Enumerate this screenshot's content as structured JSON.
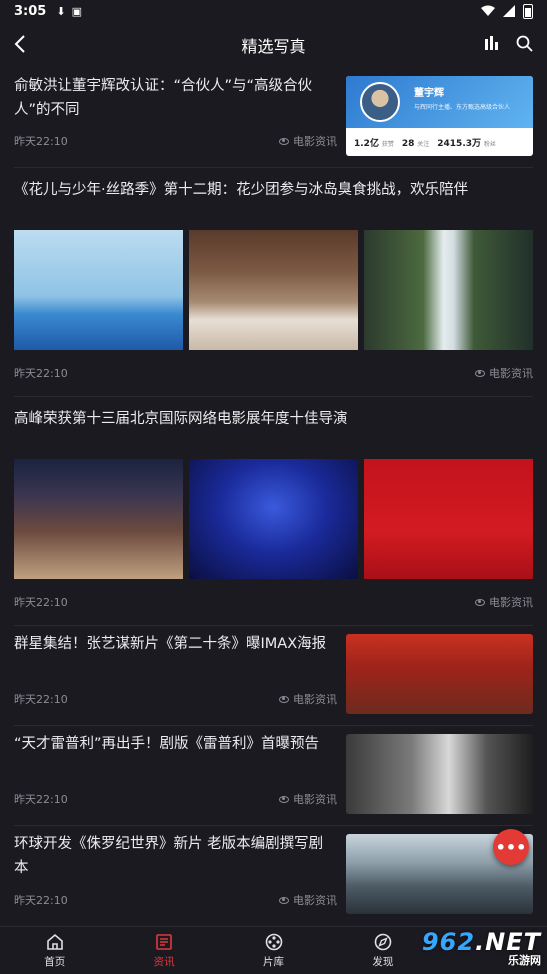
{
  "status": {
    "time": "3:05"
  },
  "header": {
    "title": "精选写真"
  },
  "feed": [
    {
      "title": "俞敏洪让董宇辉改认证：“合伙人”与“高级合伙人”的不同",
      "time": "昨天22:10",
      "source": "电影资讯",
      "profile": {
        "name": "董宇辉",
        "desc": "与辉同行主播、东方甄选高级合伙人",
        "stats": [
          {
            "value": "1.2亿",
            "label": "获赞"
          },
          {
            "value": "28",
            "label": "关注"
          },
          {
            "value": "2415.3万",
            "label": "粉丝"
          }
        ]
      }
    },
    {
      "title": "《花儿与少年·丝路季》第十二期：花少团参与冰岛臭食挑战，欢乐陪伴",
      "time": "昨天22:10",
      "source": "电影资讯"
    },
    {
      "title": "高峰荣获第十三届北京国际网络电影展年度十佳导演",
      "time": "昨天22:10",
      "source": "电影资讯"
    },
    {
      "title": "群星集结！张艺谋新片《第二十条》曝IMAX海报",
      "time": "昨天22:10",
      "source": "电影资讯"
    },
    {
      "title": "“天才雷普利”再出手！剧版《雷普利》首曝预告",
      "time": "昨天22:10",
      "source": "电影资讯"
    },
    {
      "title": "环球开发《侏罗纪世界》新片 老版本编剧撰写剧本",
      "time": "昨天22:10",
      "source": "电影资讯"
    }
  ],
  "fab": {
    "label": "•••"
  },
  "tabs": [
    {
      "label": "首页"
    },
    {
      "label": "资讯"
    },
    {
      "label": "片库"
    },
    {
      "label": "发现"
    }
  ],
  "watermark": {
    "brand": "962",
    "suffix": ".NET",
    "sub": "乐游网"
  },
  "colors": {
    "accent": "#e0383d",
    "background": "#1b1a20"
  }
}
